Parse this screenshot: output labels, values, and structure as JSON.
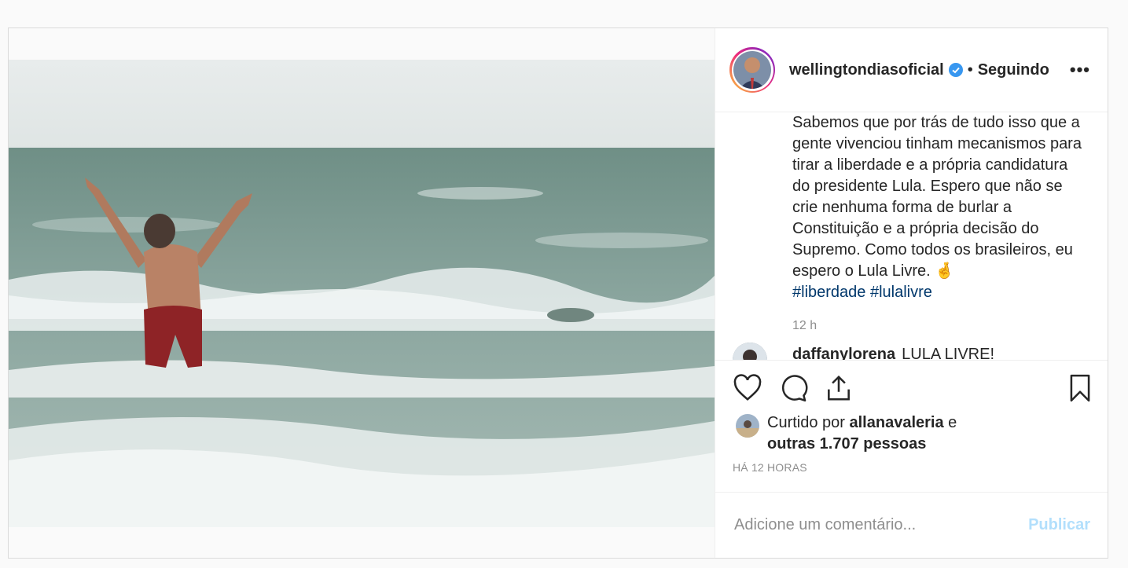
{
  "post": {
    "username": "wellingtondiasoficial",
    "separator": "•",
    "follow_status": "Seguindo",
    "more": "•••"
  },
  "caption": {
    "text": "Sabemos que por trás de tudo isso que a gente vivenciou tinham mecanismos para tirar a liberdade e a própria candidatura do presidente Lula. Espero que não se crie nenhuma forma de burlar a Constituição e a própria decisão do Supremo. Como todos os brasileiros, eu espero o Lula Livre. 🤞",
    "hashtags": [
      "#liberdade",
      "#lulalivre"
    ],
    "time": "12 h"
  },
  "next_comment": {
    "username": "daffanylorena",
    "text": "LULA LIVRE!"
  },
  "likes": {
    "prefix": "Curtido por",
    "liker": "allanavaleria",
    "conj": "e",
    "others": "outras 1.707 pessoas"
  },
  "posted_ago": "HÁ 12 HORAS",
  "comment_box": {
    "placeholder": "Adicione um comentário...",
    "publish": "Publicar"
  },
  "colors": {
    "verified": "#3897f0",
    "hashtag": "#00376b",
    "publish_disabled": "#b2dffc"
  },
  "icons": [
    "heart-icon",
    "comment-icon",
    "share-icon",
    "bookmark-icon",
    "verified-icon"
  ]
}
